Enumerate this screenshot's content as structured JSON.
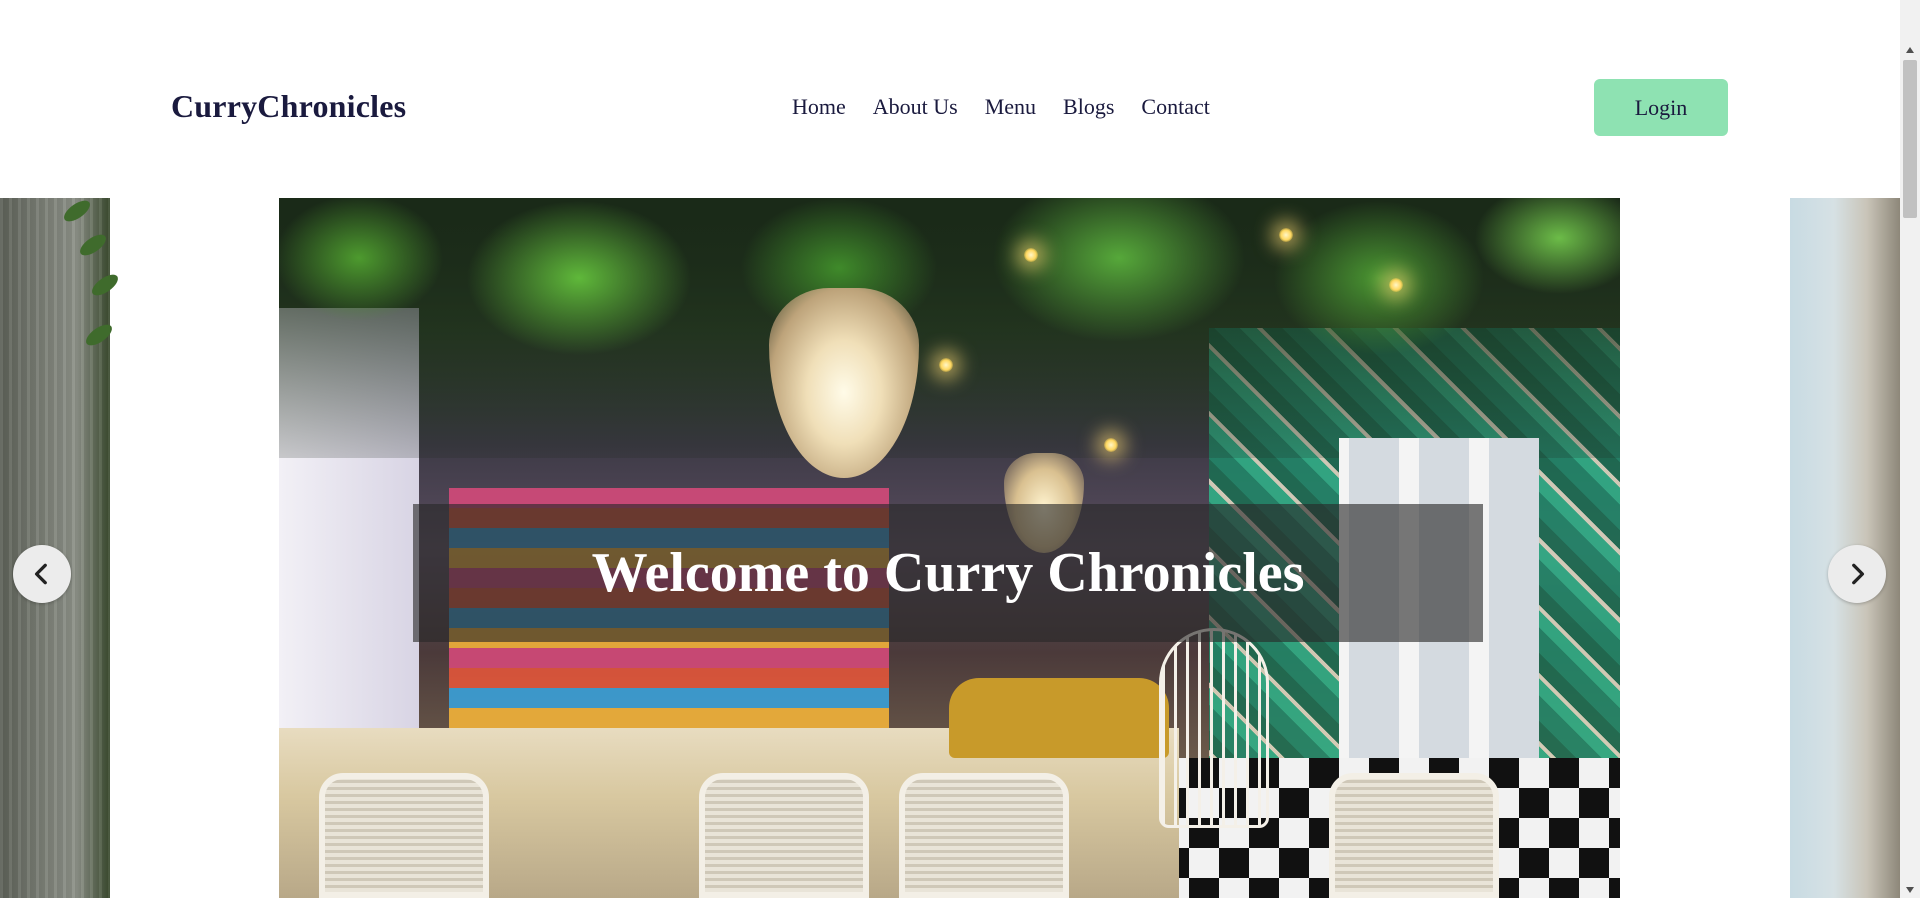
{
  "header": {
    "brand": "CurryChronicles",
    "nav": [
      {
        "label": "Home"
      },
      {
        "label": "About Us"
      },
      {
        "label": "Menu"
      },
      {
        "label": "Blogs"
      },
      {
        "label": "Contact"
      }
    ],
    "login_label": "Login"
  },
  "hero": {
    "title": "Welcome to Curry Chronicles",
    "prev_icon": "chevron-left-icon",
    "next_icon": "chevron-right-icon"
  },
  "colors": {
    "brand_text": "#1a1a3e",
    "login_bg": "#8ee2b2",
    "caption_bg": "rgba(40,40,40,0.62)",
    "arrow_bg": "#ececec"
  }
}
